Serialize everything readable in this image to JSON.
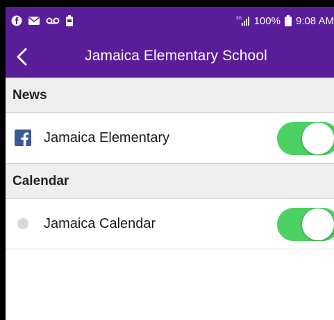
{
  "status_bar": {
    "battery": "100%",
    "time": "9:08 AM",
    "network": "3G"
  },
  "header": {
    "title": "Jamaica Elementary School"
  },
  "sections": [
    {
      "heading": "News",
      "items": [
        {
          "label": "Jamaica Elementary",
          "icon": "facebook-icon",
          "enabled": true
        }
      ]
    },
    {
      "heading": "Calendar",
      "items": [
        {
          "label": "Jamaica Calendar",
          "icon": "calendar-dot-icon",
          "enabled": true
        }
      ]
    }
  ],
  "colors": {
    "brand": "#5a1d9a",
    "toggle_on": "#4cd163",
    "facebook": "#3b5998"
  }
}
